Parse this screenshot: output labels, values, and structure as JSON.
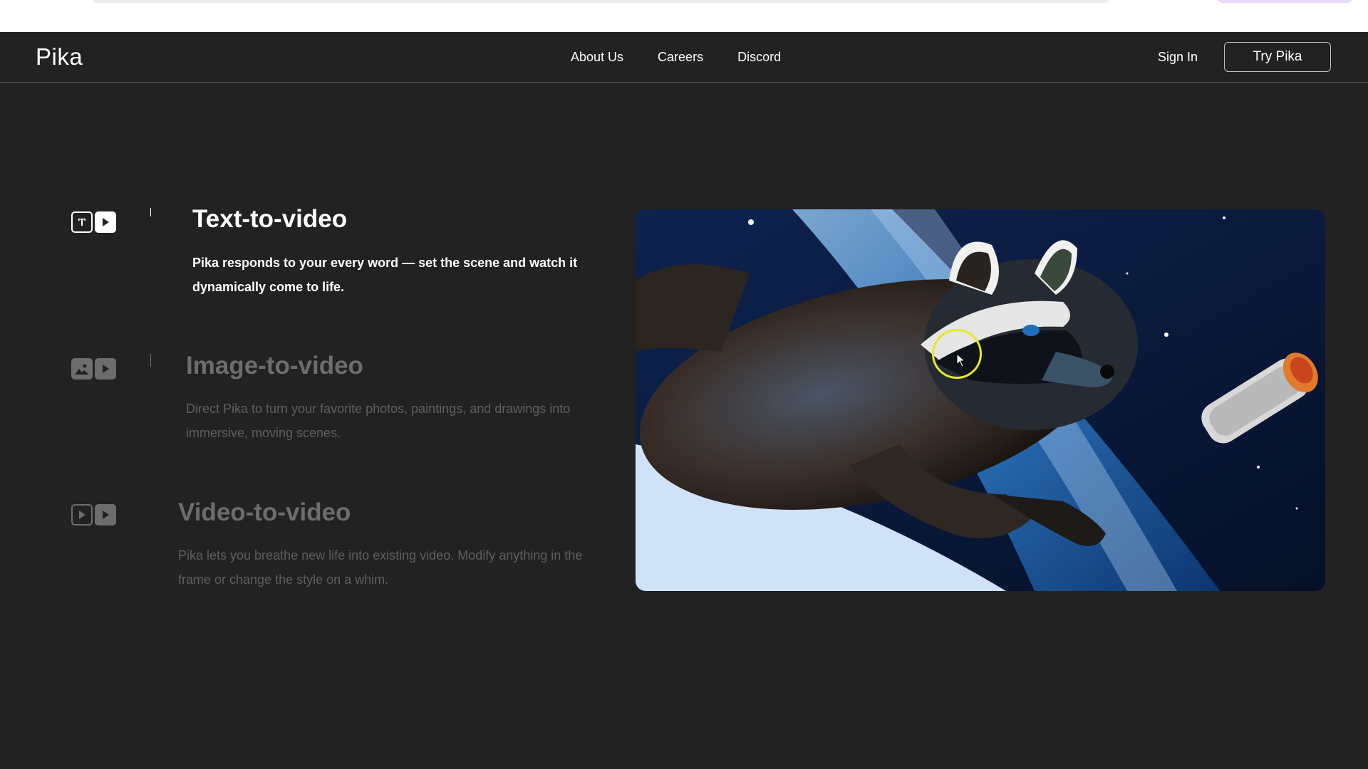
{
  "nav": {
    "logo": "Pika",
    "links": [
      "About Us",
      "Careers",
      "Discord"
    ],
    "sign_in": "Sign In",
    "cta": "Try Pika"
  },
  "features": [
    {
      "title": "Text-to-video",
      "description": "Pika responds to your every word — set the scene and watch it dynamically come to life.",
      "icon": "text-to-video-icon",
      "active": true
    },
    {
      "title": "Image-to-video",
      "description": "Direct Pika to turn your favorite photos, paintings, and drawings into immersive, moving scenes.",
      "icon": "image-to-video-icon",
      "active": false
    },
    {
      "title": "Video-to-video",
      "description": "Pika lets you breathe new life into existing video. Modify anything in the frame or change the style on a whim.",
      "icon": "video-to-video-icon",
      "active": false
    }
  ],
  "colors": {
    "background": "#222222",
    "active_text": "#ffffff",
    "dim_text": "#6d6d6d",
    "cursor_highlight": "#e8e826"
  }
}
